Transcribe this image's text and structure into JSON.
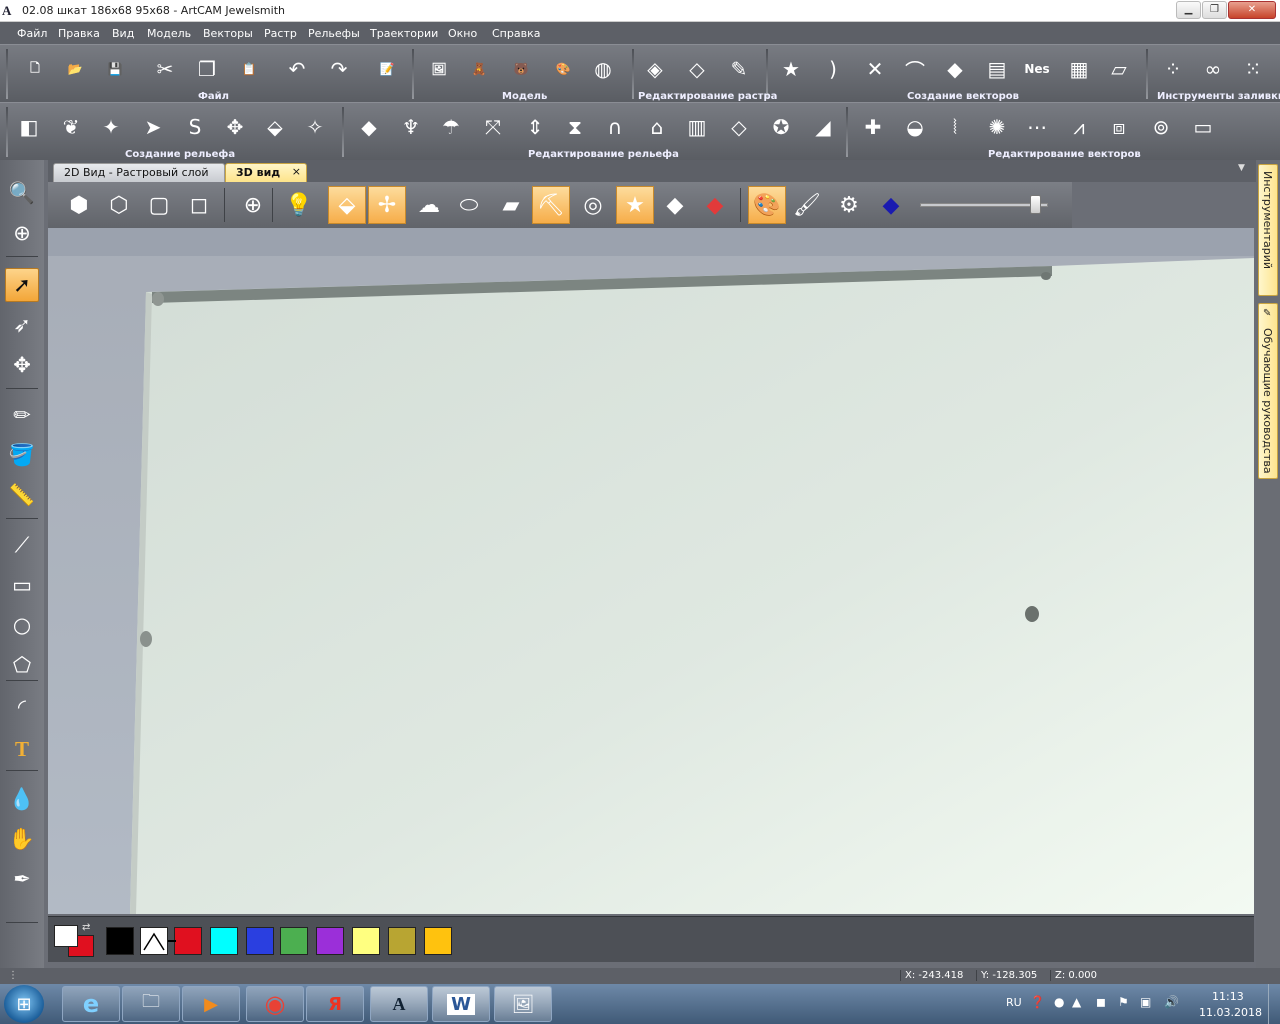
{
  "window": {
    "title": "02.08 шкат 186х68 95х68 - ArtCAM Jewelsmith",
    "app_icon": "artcam-icon",
    "min_icon": "minimize-icon",
    "max_icon": "maximize-icon",
    "close_icon": "close-icon"
  },
  "menu": [
    "Файл",
    "Правка",
    "Вид",
    "Модель",
    "Векторы",
    "Растр",
    "Рельефы",
    "Траектории",
    "Окно",
    "Справка"
  ],
  "toolbar_groups": {
    "file": "Файл",
    "model": "Модель",
    "raster_edit": "Редактирование растра",
    "vector_create": "Создание векторов",
    "fill_tools": "Инструменты заливки",
    "relief_create": "Создание рельефа",
    "relief_edit": "Редактирование рельефа",
    "vector_edit": "Редактирование векторов"
  },
  "toolbar_row1": [
    {
      "name": "new-file",
      "glyph": "🗋"
    },
    {
      "name": "open-folder",
      "glyph": "📂"
    },
    {
      "name": "save",
      "glyph": "💾"
    },
    {
      "name": "cut",
      "glyph": "✂"
    },
    {
      "name": "copy",
      "glyph": "❐"
    },
    {
      "name": "paste",
      "glyph": "📋"
    },
    {
      "name": "undo",
      "glyph": "↶"
    },
    {
      "name": "redo",
      "glyph": "↷"
    },
    {
      "name": "notes",
      "glyph": "📝"
    },
    {
      "name": "model-image",
      "glyph": "🖼"
    },
    {
      "name": "model-bear",
      "glyph": "🧸"
    },
    {
      "name": "model-bear-dark",
      "glyph": "🐻"
    },
    {
      "name": "model-paint",
      "glyph": "🎨"
    },
    {
      "name": "model-mesh",
      "glyph": "◍"
    },
    {
      "name": "raster-eraser",
      "glyph": "◈"
    },
    {
      "name": "raster-outline",
      "glyph": "◇"
    },
    {
      "name": "raster-palette",
      "glyph": "✎"
    },
    {
      "name": "vector-star",
      "glyph": "★"
    },
    {
      "name": "vector-arc",
      "glyph": ")"
    },
    {
      "name": "vector-trim",
      "glyph": "✕"
    },
    {
      "name": "vector-bow",
      "glyph": "⌒"
    },
    {
      "name": "vector-shapes",
      "glyph": "◆"
    },
    {
      "name": "vector-layers",
      "glyph": "▤"
    },
    {
      "name": "vector-nesting",
      "glyph": "Nes"
    },
    {
      "name": "vector-text-grid",
      "glyph": "▦"
    },
    {
      "name": "vector-stack",
      "glyph": "▱"
    },
    {
      "name": "fill-scatter",
      "glyph": "⁘"
    },
    {
      "name": "fill-chain",
      "glyph": "∞"
    },
    {
      "name": "fill-dots",
      "glyph": "⁙"
    }
  ],
  "toolbar_row2": [
    {
      "name": "relief-shapes",
      "glyph": "◧"
    },
    {
      "name": "relief-leaf",
      "glyph": "❦"
    },
    {
      "name": "relief-star",
      "glyph": "✦"
    },
    {
      "name": "relief-sweep",
      "glyph": "➤"
    },
    {
      "name": "relief-s",
      "glyph": "S"
    },
    {
      "name": "relief-knot",
      "glyph": "✥"
    },
    {
      "name": "relief-layer",
      "glyph": "⬙"
    },
    {
      "name": "relief-star-layer",
      "glyph": "✧"
    },
    {
      "name": "edit-plane",
      "glyph": "◆"
    },
    {
      "name": "edit-spike",
      "glyph": "♆"
    },
    {
      "name": "edit-mushroom",
      "glyph": "☂"
    },
    {
      "name": "edit-bend",
      "glyph": "⤧"
    },
    {
      "name": "edit-scale",
      "glyph": "⇕"
    },
    {
      "name": "edit-pinch",
      "glyph": "⧗"
    },
    {
      "name": "edit-arch",
      "glyph": "∩"
    },
    {
      "name": "edit-hat",
      "glyph": "⌂"
    },
    {
      "name": "edit-frame",
      "glyph": "▥"
    },
    {
      "name": "edit-tile",
      "glyph": "◇"
    },
    {
      "name": "edit-star-ball",
      "glyph": "✪"
    },
    {
      "name": "edit-smooth",
      "glyph": "◢"
    },
    {
      "name": "vec-add",
      "glyph": "✚"
    },
    {
      "name": "vec-bowl",
      "glyph": "◒"
    },
    {
      "name": "vec-pinch",
      "glyph": "⦚"
    },
    {
      "name": "vec-wave-star",
      "glyph": "✺"
    },
    {
      "name": "vec-nodes",
      "glyph": "⋯"
    },
    {
      "name": "vec-bell",
      "glyph": "⩘"
    },
    {
      "name": "vec-offset",
      "glyph": "⧈"
    },
    {
      "name": "vec-blend",
      "glyph": "⊚"
    },
    {
      "name": "vec-rounded",
      "glyph": "▭"
    }
  ],
  "left_tools": [
    {
      "name": "zoom-box",
      "glyph": "🔍"
    },
    {
      "name": "globe",
      "glyph": "⊕"
    },
    {
      "name": "select-arrow",
      "glyph": "➚"
    },
    {
      "name": "node-edit",
      "glyph": "➶"
    },
    {
      "name": "transform",
      "glyph": "✥"
    },
    {
      "name": "pencil",
      "glyph": "✏"
    },
    {
      "name": "paint-bucket",
      "glyph": "🪣"
    },
    {
      "name": "measure",
      "glyph": "📏"
    },
    {
      "name": "polyline",
      "glyph": "⟋"
    },
    {
      "name": "rectangle",
      "glyph": "▭"
    },
    {
      "name": "circle",
      "glyph": "○"
    },
    {
      "name": "polygon",
      "glyph": "⬠"
    },
    {
      "name": "arc",
      "glyph": "◜"
    },
    {
      "name": "text",
      "glyph": "T"
    },
    {
      "name": "drop",
      "glyph": "💧"
    },
    {
      "name": "sculpt",
      "glyph": "✋"
    },
    {
      "name": "pen",
      "glyph": "✒"
    }
  ],
  "tabs": {
    "tab_2d": "2D Вид - Растровый слой",
    "tab_3d": "3D вид",
    "close": "×",
    "menu": "▼"
  },
  "view_tools": [
    {
      "name": "iso-view",
      "glyph": "⬢",
      "on": false
    },
    {
      "name": "wire-front",
      "glyph": "⬡",
      "on": false
    },
    {
      "name": "wire-side",
      "glyph": "▢",
      "on": false
    },
    {
      "name": "wire-top",
      "glyph": "◻",
      "on": false
    },
    {
      "name": "zoom",
      "glyph": "⊕",
      "on": false
    },
    {
      "name": "light",
      "glyph": "💡",
      "on": false
    },
    {
      "name": "show-plane",
      "glyph": "⬙",
      "on": true
    },
    {
      "name": "axes",
      "glyph": "✢",
      "on": true
    },
    {
      "name": "texture",
      "glyph": "☁",
      "on": false
    },
    {
      "name": "material",
      "glyph": "⬭",
      "on": false
    },
    {
      "name": "relief-pattern",
      "glyph": "▰",
      "on": false
    },
    {
      "name": "toolpath-view",
      "glyph": "⛏",
      "on": true
    },
    {
      "name": "vectors-3d",
      "glyph": "◎",
      "on": false
    },
    {
      "name": "star-view",
      "glyph": "★",
      "on": true
    },
    {
      "name": "layers-view",
      "glyph": "◆",
      "on": false
    },
    {
      "name": "red-layer",
      "glyph": "◆",
      "on": false
    },
    {
      "name": "colour-paint",
      "glyph": "🎨",
      "on": true
    },
    {
      "name": "brush",
      "glyph": "🖌",
      "on": false
    },
    {
      "name": "render-settings",
      "glyph": "⚙",
      "on": false
    },
    {
      "name": "colour-shade",
      "glyph": "◆",
      "on": false
    }
  ],
  "zoom_level": 0.93,
  "palette": [
    {
      "name": "black",
      "color": "#000000"
    },
    {
      "name": "white",
      "color": "#ffffff"
    },
    {
      "name": "red",
      "color": "#e0101f"
    },
    {
      "name": "cyan",
      "color": "#00ffff"
    },
    {
      "name": "blue",
      "color": "#2a3fe0"
    },
    {
      "name": "green",
      "color": "#4caf50"
    },
    {
      "name": "purple",
      "color": "#9b2fd9"
    },
    {
      "name": "light-yellow",
      "color": "#ffff80"
    },
    {
      "name": "olive",
      "color": "#b8a532"
    },
    {
      "name": "gold",
      "color": "#ffc20e"
    }
  ],
  "palette_primary": "#ffffff",
  "palette_secondary": "#e0101f",
  "side_tabs": {
    "tools": "Инструментарий",
    "tutorials": "Обучающие руководства"
  },
  "status": {
    "x": "X: -243.418",
    "y": "Y: -128.305",
    "z": "Z: 0.000"
  },
  "taskbar": {
    "apps": [
      {
        "name": "internet-explorer",
        "glyph": "e"
      },
      {
        "name": "file-explorer",
        "glyph": "🗀"
      },
      {
        "name": "media-player",
        "glyph": "▶"
      },
      {
        "name": "chrome",
        "glyph": "◉"
      },
      {
        "name": "yandex",
        "glyph": "Я"
      },
      {
        "name": "artcam",
        "glyph": "A"
      },
      {
        "name": "word",
        "glyph": "W"
      },
      {
        "name": "picture-viewer",
        "glyph": "🖼"
      }
    ],
    "lang": "RU",
    "time": "11:13",
    "date": "11.03.2018"
  },
  "colors": {
    "accent": "#f6ad49",
    "tab_active": "#fde48a",
    "viewport_bg": "#b2bac5",
    "relief_plane": "#dfe7df"
  }
}
